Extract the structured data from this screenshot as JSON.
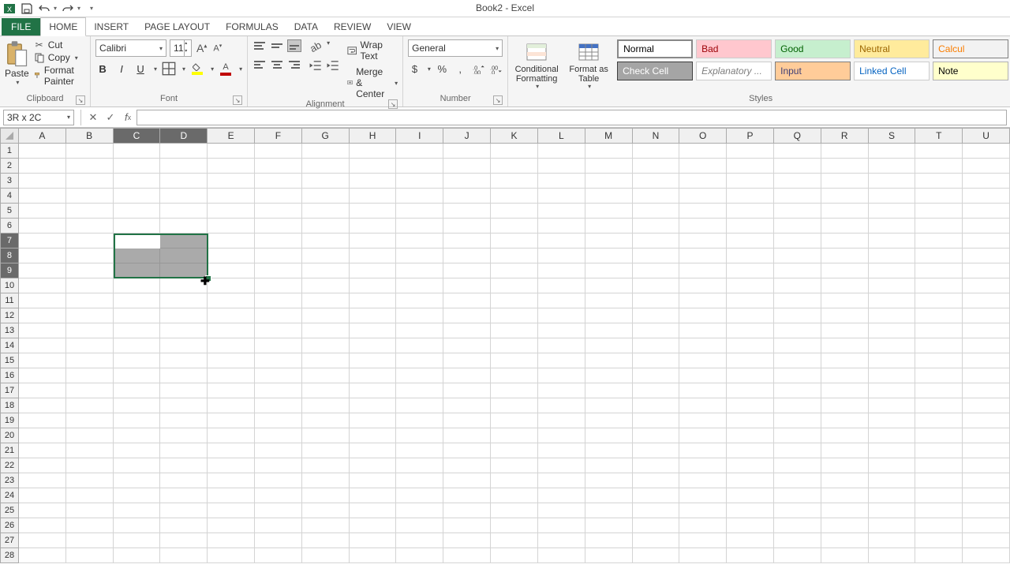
{
  "titlebar": {
    "title": "Book2 - Excel"
  },
  "tabs": {
    "file": "FILE",
    "items": [
      "HOME",
      "INSERT",
      "PAGE LAYOUT",
      "FORMULAS",
      "DATA",
      "REVIEW",
      "VIEW"
    ],
    "active": "HOME"
  },
  "ribbon": {
    "clipboard": {
      "label": "Clipboard",
      "paste": "Paste",
      "cut": "Cut",
      "copy": "Copy",
      "format_painter": "Format Painter"
    },
    "font": {
      "label": "Font",
      "name": "Calibri",
      "size": "11"
    },
    "alignment": {
      "label": "Alignment",
      "wrap": "Wrap Text",
      "merge": "Merge & Center"
    },
    "number": {
      "label": "Number",
      "format": "General"
    },
    "styles": {
      "label": "Styles",
      "cond": "Conditional Formatting",
      "table": "Format as Table",
      "gallery": [
        {
          "label": "Normal",
          "bg": "#ffffff",
          "color": "#000",
          "border": "#888"
        },
        {
          "label": "Bad",
          "bg": "#ffc7ce",
          "color": "#9c0006",
          "border": "#ccc"
        },
        {
          "label": "Good",
          "bg": "#c6efce",
          "color": "#006100",
          "border": "#ccc"
        },
        {
          "label": "Neutral",
          "bg": "#ffeb9c",
          "color": "#9c6500",
          "border": "#ccc"
        },
        {
          "label": "Calcul",
          "bg": "#f2f2f2",
          "color": "#fa7d00",
          "border": "#7f7f7f"
        },
        {
          "label": "Check Cell",
          "bg": "#a5a5a5",
          "color": "#fff",
          "border": "#3f3f3f"
        },
        {
          "label": "Explanatory ...",
          "bg": "#fff",
          "color": "#7f7f7f",
          "border": "#ccc",
          "italic": true
        },
        {
          "label": "Input",
          "bg": "#ffcc99",
          "color": "#3f3f76",
          "border": "#7f7f7f"
        },
        {
          "label": "Linked Cell",
          "bg": "#fff",
          "color": "#0563c1",
          "border": "#ccc"
        },
        {
          "label": "Note",
          "bg": "#ffffcc",
          "color": "#000",
          "border": "#b2b2b2"
        }
      ]
    }
  },
  "formula_bar": {
    "namebox": "3R x 2C",
    "value": ""
  },
  "grid": {
    "columns": [
      "A",
      "B",
      "C",
      "D",
      "E",
      "F",
      "G",
      "H",
      "I",
      "J",
      "K",
      "L",
      "M",
      "N",
      "O",
      "P",
      "Q",
      "R",
      "S",
      "T",
      "U"
    ],
    "rows": 28,
    "sel_cols": [
      "C",
      "D"
    ],
    "sel_rows": [
      7,
      8,
      9
    ],
    "active_cell": "C7"
  }
}
